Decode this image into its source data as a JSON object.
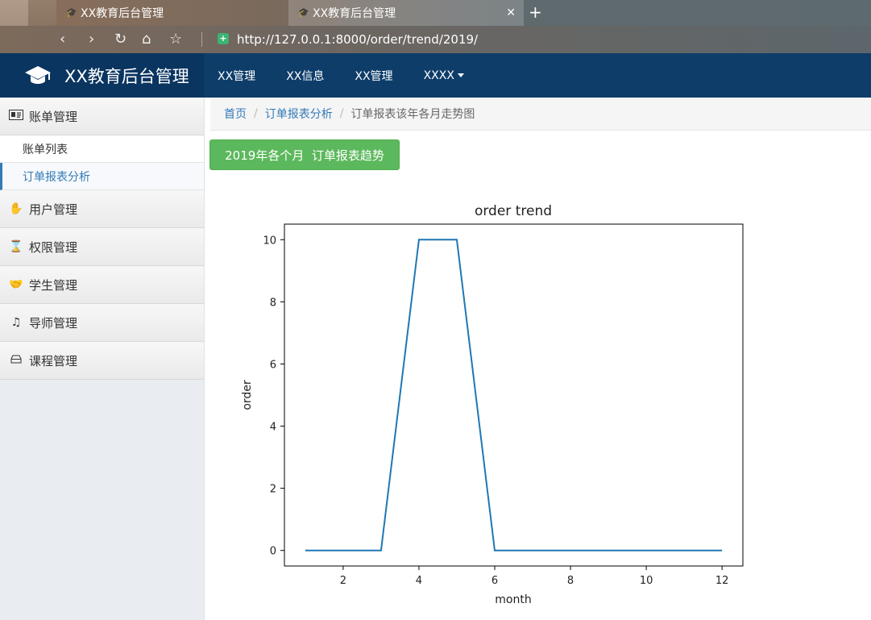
{
  "browser": {
    "tabs": [
      {
        "title": "XX教育后台管理",
        "active": false
      },
      {
        "title": "XX教育后台管理",
        "active": true
      }
    ],
    "url": "http://127.0.0.1:8000/order/trend/2019/"
  },
  "header": {
    "brand": "XX教育后台管理",
    "nav": [
      {
        "label": "XX管理"
      },
      {
        "label": "XX信息"
      },
      {
        "label": "XX管理"
      },
      {
        "label": "XXXX"
      }
    ]
  },
  "sidebar": {
    "groups": [
      {
        "label": "账单管理",
        "icon": "id-card-icon",
        "items": [
          {
            "label": "账单列表",
            "active": false
          },
          {
            "label": "订单报表分析",
            "active": true
          }
        ]
      },
      {
        "label": "用户管理",
        "icon": "hand-icon"
      },
      {
        "label": "权限管理",
        "icon": "hourglass-icon"
      },
      {
        "label": "学生管理",
        "icon": "handshake-icon"
      },
      {
        "label": "导师管理",
        "icon": "ear-icon"
      },
      {
        "label": "课程管理",
        "icon": "hdd-icon"
      }
    ]
  },
  "breadcrumb": {
    "items": [
      "首页",
      "订单报表分析"
    ],
    "current": "订单报表该年各月走势图"
  },
  "main": {
    "title_button": "2019年各个月  订单报表趋势"
  },
  "colors": {
    "header_bg": "#0e3d6a",
    "link": "#337ab7",
    "success": "#5cb85c",
    "line": "#1f77b4"
  },
  "chart_data": {
    "type": "line",
    "title": "order trend",
    "xlabel": "month",
    "ylabel": "order",
    "x": [
      1,
      2,
      3,
      4,
      5,
      6,
      7,
      8,
      9,
      10,
      11,
      12
    ],
    "series": [
      {
        "values": [
          0,
          0,
          0,
          10,
          10,
          0,
          0,
          0,
          0,
          0,
          0,
          0
        ]
      }
    ],
    "xticks": [
      2,
      4,
      6,
      8,
      10,
      12
    ],
    "yticks": [
      0,
      2,
      4,
      6,
      8,
      10
    ],
    "xlim": [
      0.45,
      12.55
    ],
    "ylim": [
      -0.5,
      10.5
    ],
    "grid": false
  }
}
